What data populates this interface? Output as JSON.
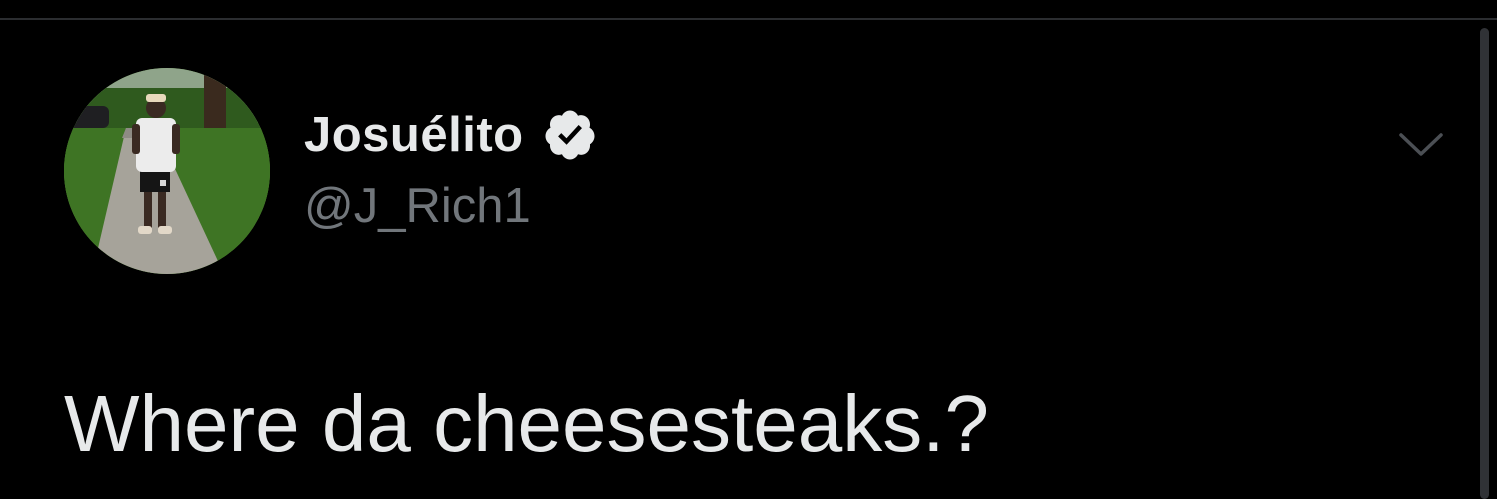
{
  "tweet": {
    "author": {
      "display_name": "Josuélito",
      "handle": "@J_Rich1",
      "verified": true
    },
    "text": "Where da cheesesteaks.?"
  },
  "icons": {
    "verified": "verified-badge-icon",
    "menu": "chevron-down-icon"
  },
  "colors": {
    "background": "#000000",
    "primary_text": "#e7e9ea",
    "secondary_text": "#71767b",
    "divider": "#2b2d30"
  }
}
